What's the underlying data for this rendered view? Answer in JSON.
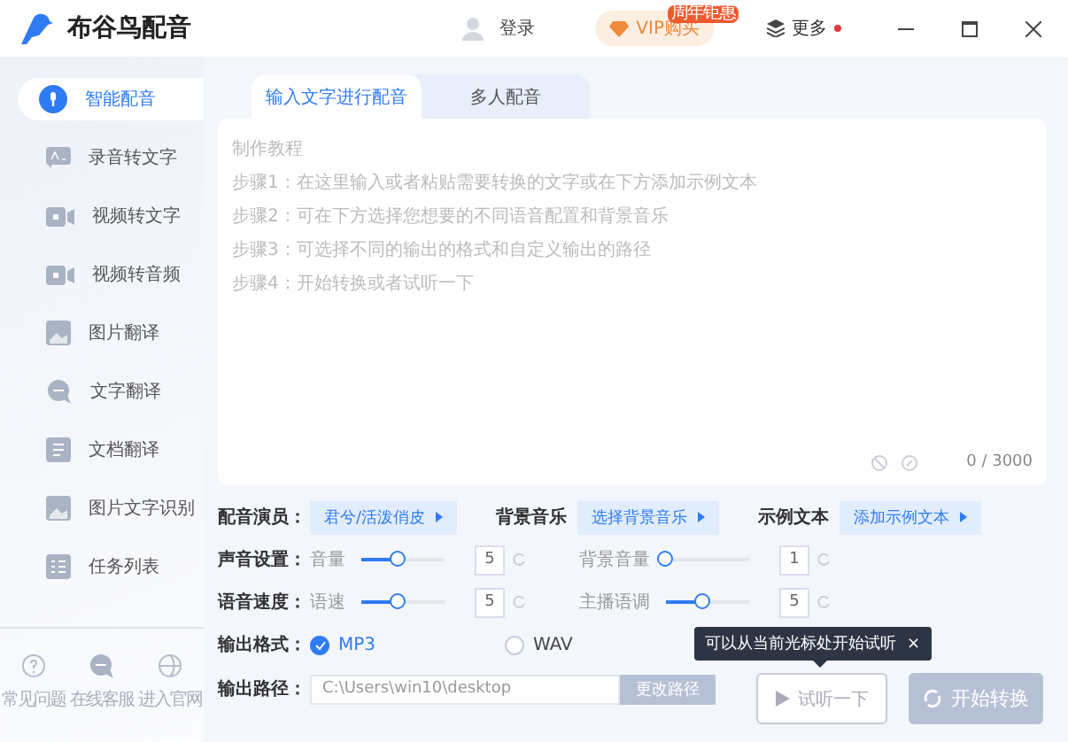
{
  "app": {
    "name": "布谷鸟配音"
  },
  "header": {
    "login": "登录",
    "vip": {
      "label": "VIP购买",
      "badge": "周年钜惠"
    },
    "more": {
      "label": "更多",
      "dot": true
    }
  },
  "sidebar": {
    "items": [
      {
        "label": "智能配音",
        "selected": true
      },
      {
        "label": "录音转文字",
        "selected": false
      },
      {
        "label": "视频转文字",
        "selected": false
      },
      {
        "label": "视频转音频",
        "selected": false
      },
      {
        "label": "图片翻译",
        "selected": false
      },
      {
        "label": "文字翻译",
        "selected": false
      },
      {
        "label": "文档翻译",
        "selected": false
      },
      {
        "label": "图片文字识别",
        "selected": false
      },
      {
        "label": "任务列表",
        "selected": false
      }
    ],
    "links": [
      {
        "label": "常见问题"
      },
      {
        "label": "在线客服"
      },
      {
        "label": "进入官网"
      }
    ]
  },
  "tabs": [
    {
      "label": "输入文字进行配音",
      "selected": true
    },
    {
      "label": "多人配音",
      "selected": false
    }
  ],
  "editor": {
    "hint_lines": [
      "制作教程",
      "步骤1：在这里输入或者粘贴需要转换的文字或在下方添加示例文本",
      "步骤2：可在下方选择您想要的不同语音配置和背景音乐",
      "步骤3：可选择不同的输出的格式和自定义输出的路径",
      "步骤4：开始转换或者试听一下"
    ],
    "counter": "0 / 3000"
  },
  "voice_row": [
    {
      "label": "配音演员：",
      "value": "君兮/活泼俏皮"
    },
    {
      "label": "背景音乐",
      "value": "选择背景音乐"
    },
    {
      "label": "示例文本",
      "value": "添加示例文本"
    }
  ],
  "slider_rows": [
    {
      "label": "声音设置：",
      "sliders": [
        {
          "name": "音量",
          "level": 0.44,
          "value": "5"
        },
        {
          "name": "背景音量",
          "level": 0,
          "value": "1"
        }
      ]
    },
    {
      "label": "语音速度：",
      "sliders": [
        {
          "name": "语速",
          "level": 0.44,
          "value": "5"
        },
        {
          "name": "主播语调",
          "level": 0.44,
          "value": "5"
        }
      ]
    }
  ],
  "format": {
    "label": "输出格式：",
    "options": [
      {
        "label": "MP3",
        "selected": true
      },
      {
        "label": "WAV",
        "selected": false
      }
    ]
  },
  "path": {
    "label": "输出路径：",
    "value": "C:\\Users\\win10\\desktop",
    "button": "更改路径"
  },
  "tooltip": {
    "text": "可以从当前光标处开始试听",
    "close": "×"
  },
  "buttons": {
    "preview": "试听一下",
    "start": "开始转换"
  }
}
